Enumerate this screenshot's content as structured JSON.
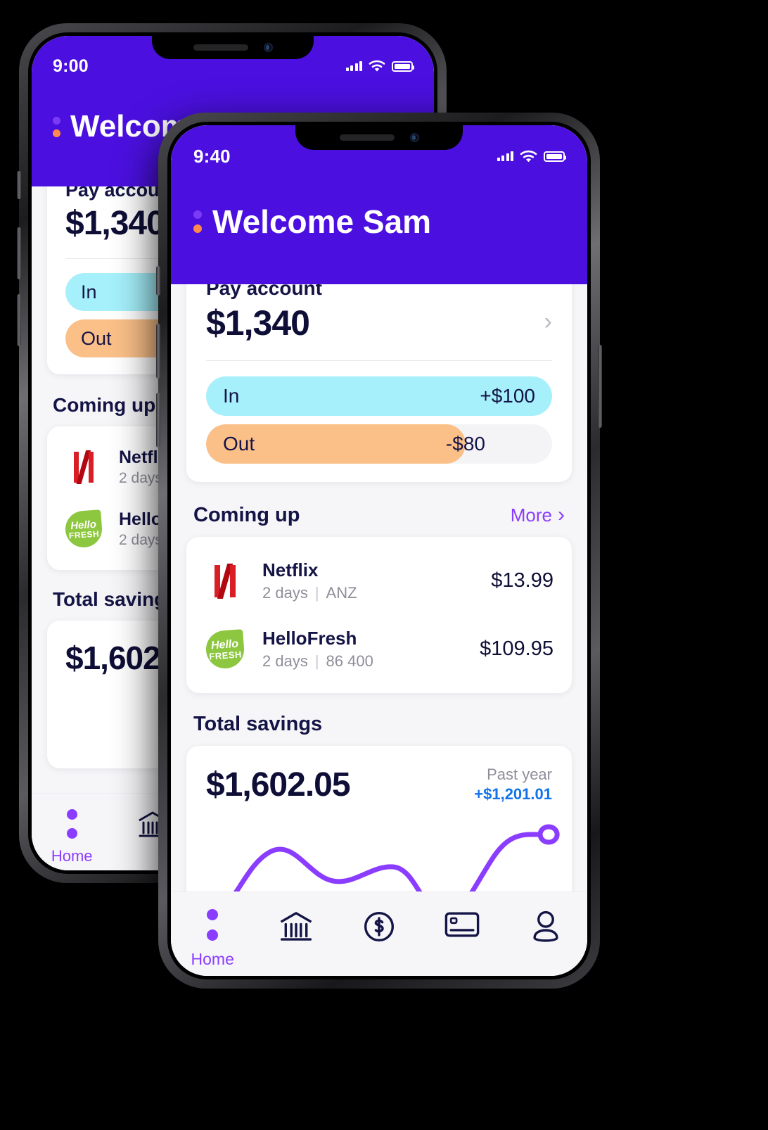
{
  "back_phone": {
    "statusbar": {
      "time": "9:00"
    },
    "greeting": "Welcome Sam"
  },
  "front_phone": {
    "statusbar": {
      "time": "9:40",
      "signal_icon": "cellular-bars-icon",
      "wifi_icon": "wifi-icon",
      "battery_icon": "battery-full-icon"
    },
    "greeting": "Welcome Sam",
    "pay_account": {
      "label": "Pay account",
      "balance": "$1,340",
      "chevron_icon": "chevron-right-icon",
      "flows": [
        {
          "label": "In",
          "value": "+$100",
          "fill_pct": 100,
          "color": "#A5F0FB"
        },
        {
          "label": "Out",
          "value": "-$80",
          "fill_pct": 75,
          "color": "#FBC088"
        }
      ]
    },
    "coming_up": {
      "title": "Coming up",
      "more_label": "More",
      "more_chevron_icon": "chevron-right-icon",
      "items": [
        {
          "logo": "netflix-logo",
          "name": "Netflix",
          "due": "2 days",
          "source": "ANZ",
          "amount": "$13.99"
        },
        {
          "logo": "hellofresh-logo",
          "name": "HelloFresh",
          "due": "2 days",
          "source": "86 400",
          "amount": "$109.95"
        }
      ]
    },
    "savings": {
      "title": "Total savings",
      "amount": "$1,602.05",
      "period_label": "Past year",
      "change": "+$1,201.01"
    },
    "tabbar": {
      "items": [
        {
          "icon": "home-dots-icon",
          "label": "Home",
          "active": true
        },
        {
          "icon": "bank-icon",
          "label": "",
          "active": false
        },
        {
          "icon": "dollar-circle-icon",
          "label": "",
          "active": false
        },
        {
          "icon": "card-icon",
          "label": "",
          "active": false
        },
        {
          "icon": "person-icon",
          "label": "",
          "active": false
        }
      ]
    }
  },
  "theme": {
    "purple": "#4B10E0",
    "accent_purple": "#8B3DFF",
    "orange": "#FF8A4C",
    "cyan": "#A5F0FB",
    "peach": "#FBC088",
    "ink": "#0E0E36",
    "blue": "#1273EB",
    "netflix_red": "#D81F26",
    "hellofresh_green": "#8DC63F"
  },
  "chart_data": {
    "type": "line",
    "title": "Total savings",
    "series": [
      {
        "name": "Savings",
        "values": [
          10,
          34,
          64,
          42,
          38,
          56,
          50,
          18,
          40,
          96,
          100,
          100
        ]
      }
    ],
    "x": [
      1,
      2,
      3,
      4,
      5,
      6,
      7,
      8,
      9,
      10,
      11,
      12
    ],
    "xlabel": "",
    "ylabel": "",
    "grid": false,
    "legend": "none",
    "endpoint_marker": true,
    "line_color": "#8B3DFF"
  }
}
